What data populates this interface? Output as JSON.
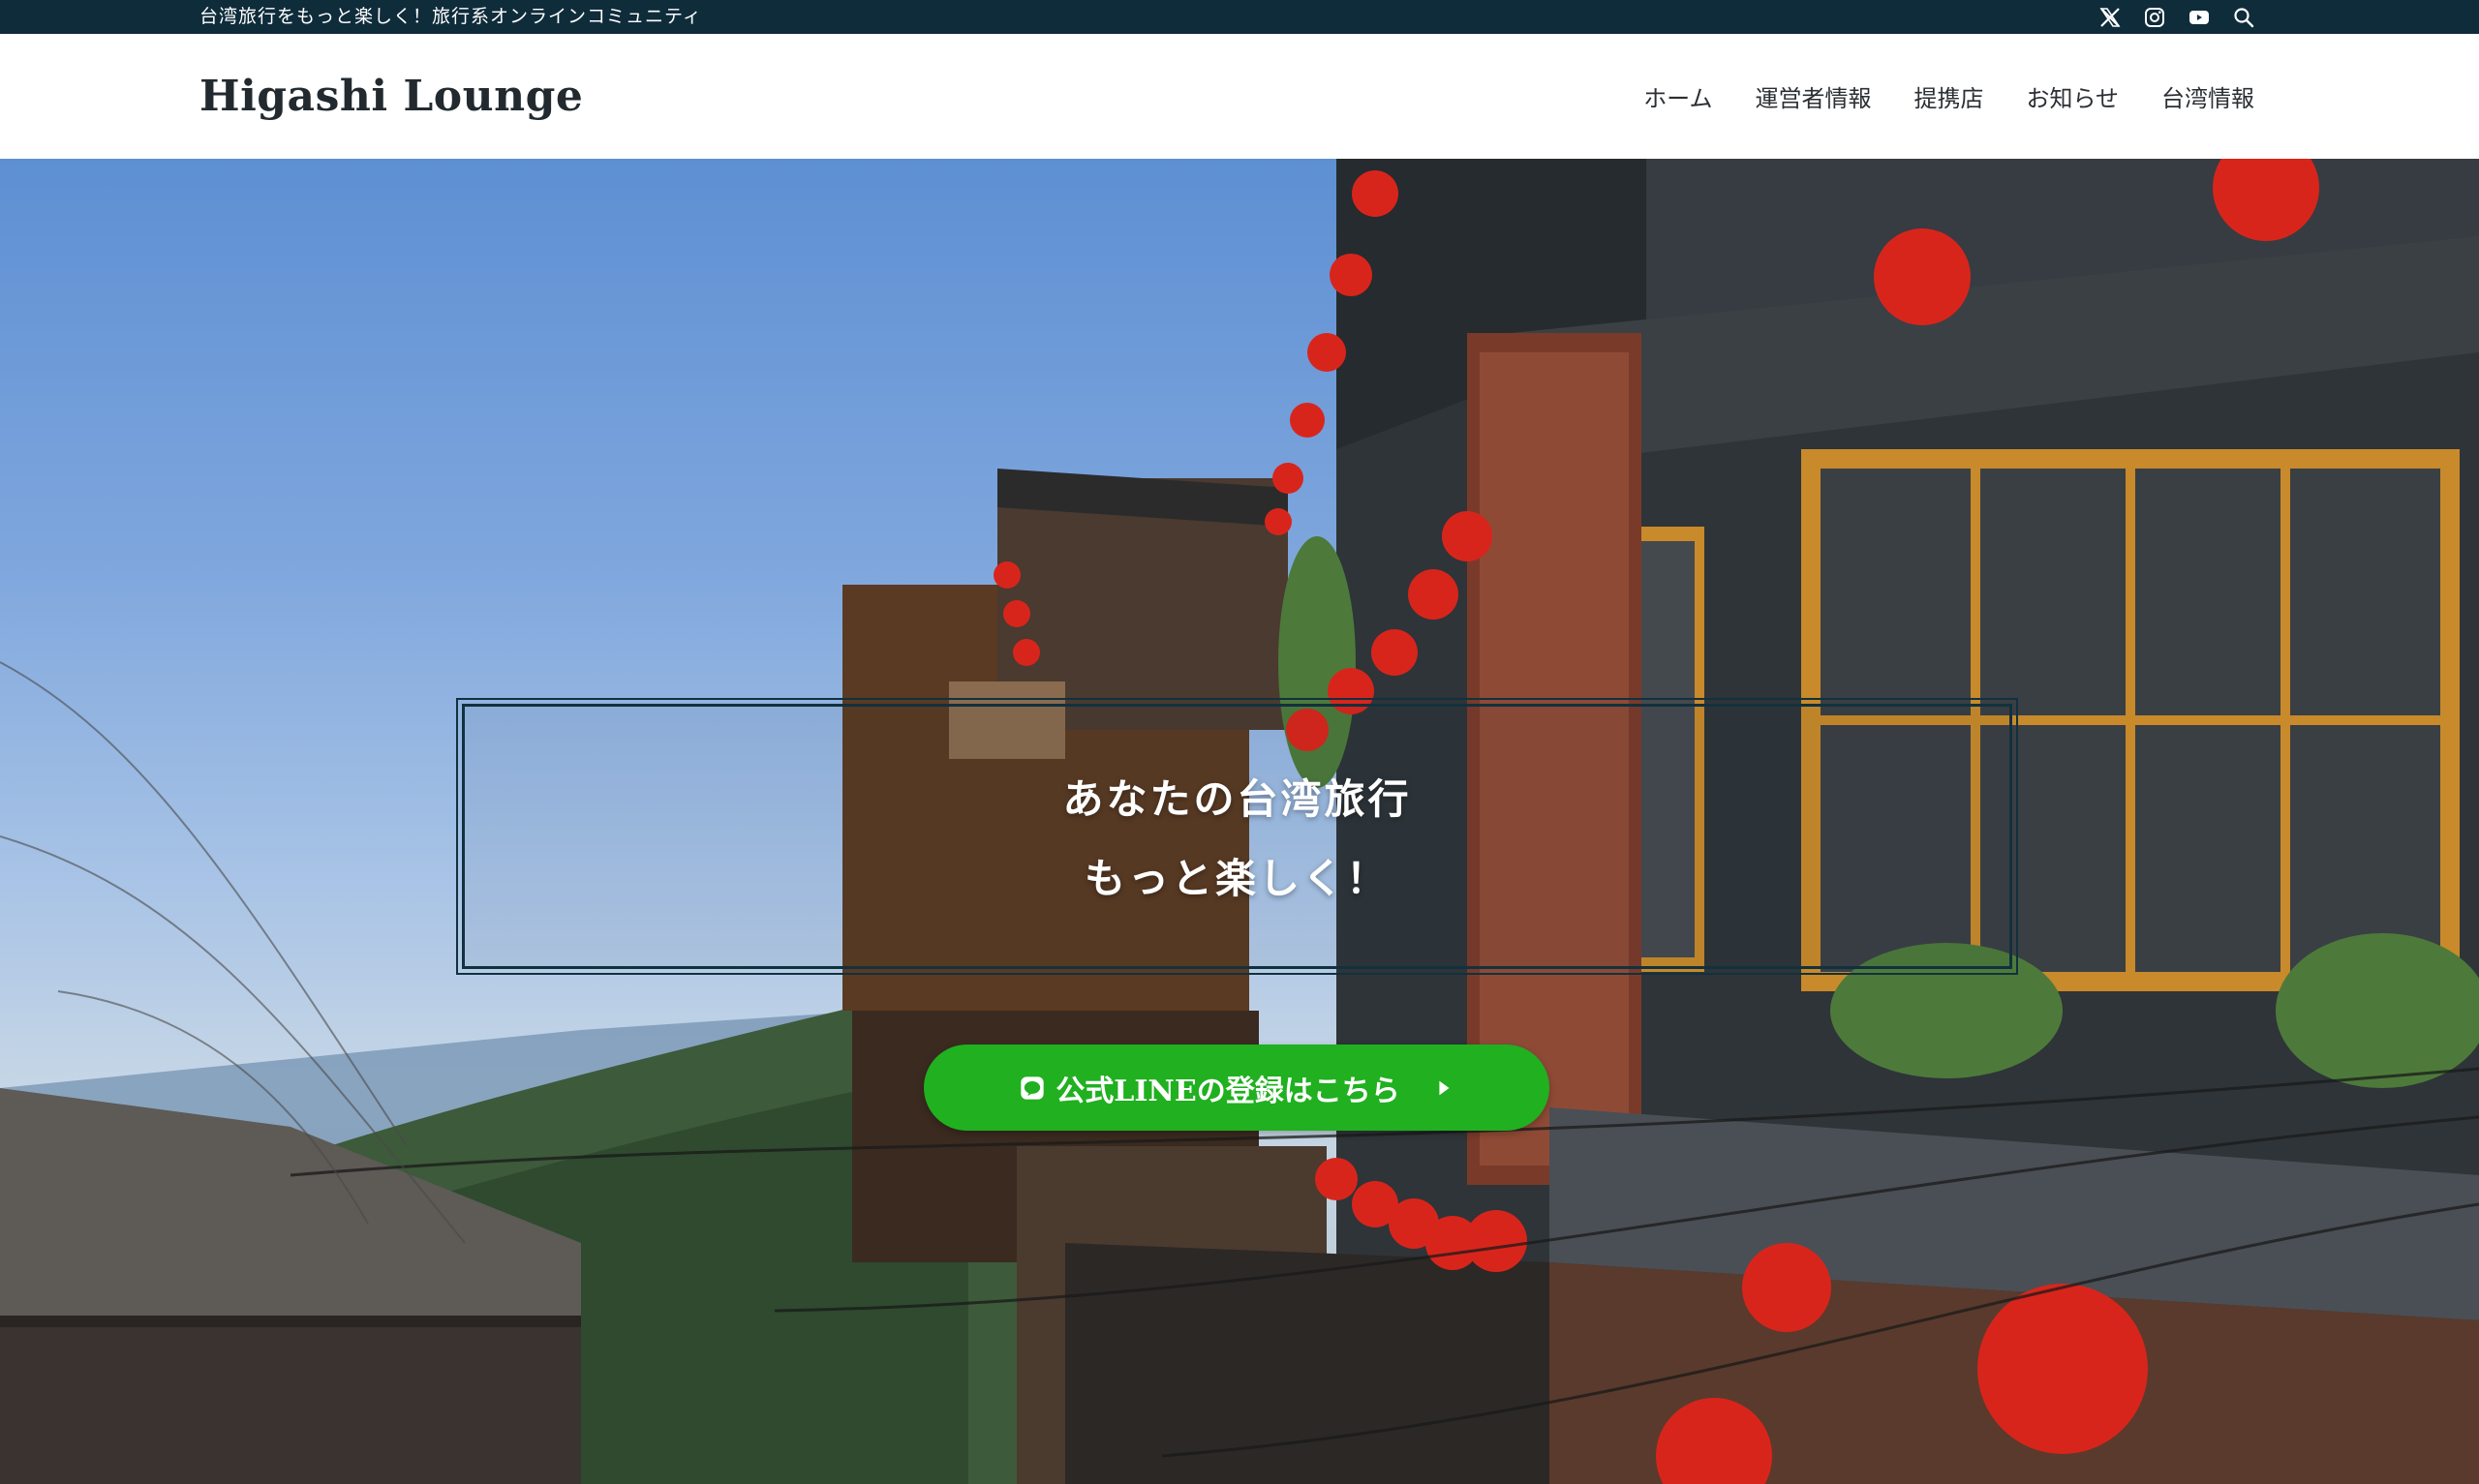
{
  "topbar": {
    "tagline": "台湾旅行をもっと楽しく！旅行系オンラインコミュニティ",
    "icons": [
      "x-icon",
      "instagram-icon",
      "youtube-icon",
      "search-icon"
    ]
  },
  "header": {
    "brand": "Higashi Lounge",
    "nav": [
      "ホーム",
      "運営者情報",
      "提携店",
      "お知らせ",
      "台湾情報"
    ]
  },
  "hero": {
    "headline_line1": "あなたの台湾旅行",
    "headline_line2": "もっと楽しく！",
    "cta_label": "公式LINEの登録はこちら"
  },
  "colors": {
    "topbar": "#0f2c3b",
    "brand_text": "#222a30",
    "cta": "#20b020",
    "box_border": "#12313e"
  }
}
